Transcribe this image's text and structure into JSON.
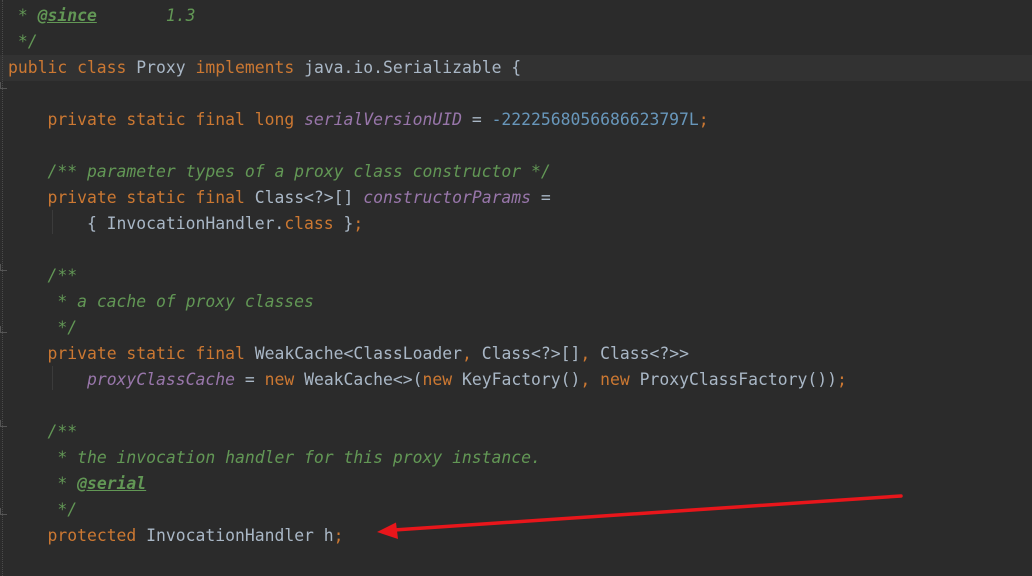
{
  "editor": {
    "lines": [
      {
        "tokens": [
          {
            "c": "cm",
            "t": " * "
          },
          {
            "c": "tag",
            "t": "@since"
          },
          {
            "c": "cm",
            "t": "       1.3"
          }
        ]
      },
      {
        "tokens": [
          {
            "c": "cm",
            "t": " */"
          }
        ]
      },
      {
        "tokens": [
          {
            "c": "kw",
            "t": "public class "
          },
          {
            "c": "plain",
            "t": "Proxy "
          },
          {
            "c": "kw",
            "t": "implements "
          },
          {
            "c": "plain",
            "t": "java.io.Serializable {"
          }
        ],
        "current": true
      },
      {
        "tokens": []
      },
      {
        "tokens": [
          {
            "c": "plain",
            "t": "    "
          },
          {
            "c": "kw",
            "t": "private static final long "
          },
          {
            "c": "fld",
            "t": "serialVersionUID"
          },
          {
            "c": "plain",
            "t": " = "
          },
          {
            "c": "num",
            "t": "-2222568056686623797L"
          },
          {
            "c": "kw",
            "t": ";"
          }
        ]
      },
      {
        "tokens": []
      },
      {
        "tokens": [
          {
            "c": "plain",
            "t": "    "
          },
          {
            "c": "cm",
            "t": "/** parameter types of a proxy class constructor */"
          }
        ]
      },
      {
        "tokens": [
          {
            "c": "plain",
            "t": "    "
          },
          {
            "c": "kw",
            "t": "private static final "
          },
          {
            "c": "plain",
            "t": "Class<?>[] "
          },
          {
            "c": "fld",
            "t": "constructorParams"
          },
          {
            "c": "plain",
            "t": " ="
          }
        ]
      },
      {
        "tokens": [
          {
            "c": "plain",
            "t": "        { InvocationHandler."
          },
          {
            "c": "kw",
            "t": "class"
          },
          {
            "c": "plain",
            "t": " }"
          },
          {
            "c": "kw",
            "t": ";"
          }
        ]
      },
      {
        "tokens": []
      },
      {
        "tokens": [
          {
            "c": "plain",
            "t": "    "
          },
          {
            "c": "cm",
            "t": "/**"
          }
        ]
      },
      {
        "tokens": [
          {
            "c": "plain",
            "t": "     "
          },
          {
            "c": "cm",
            "t": "* a cache of proxy classes"
          }
        ]
      },
      {
        "tokens": [
          {
            "c": "plain",
            "t": "     "
          },
          {
            "c": "cm",
            "t": "*/"
          }
        ]
      },
      {
        "tokens": [
          {
            "c": "plain",
            "t": "    "
          },
          {
            "c": "kw",
            "t": "private static final "
          },
          {
            "c": "plain",
            "t": "WeakCache<ClassLoader"
          },
          {
            "c": "kw",
            "t": ", "
          },
          {
            "c": "plain",
            "t": "Class<?>[]"
          },
          {
            "c": "kw",
            "t": ", "
          },
          {
            "c": "plain",
            "t": "Class<?>>"
          }
        ]
      },
      {
        "tokens": [
          {
            "c": "plain",
            "t": "        "
          },
          {
            "c": "fld",
            "t": "proxyClassCache"
          },
          {
            "c": "plain",
            "t": " = "
          },
          {
            "c": "kw",
            "t": "new "
          },
          {
            "c": "plain",
            "t": "WeakCache<>("
          },
          {
            "c": "kw",
            "t": "new "
          },
          {
            "c": "plain",
            "t": "KeyFactory()"
          },
          {
            "c": "kw",
            "t": ", new "
          },
          {
            "c": "plain",
            "t": "ProxyClassFactory())"
          },
          {
            "c": "kw",
            "t": ";"
          }
        ]
      },
      {
        "tokens": []
      },
      {
        "tokens": [
          {
            "c": "plain",
            "t": "    "
          },
          {
            "c": "cm",
            "t": "/**"
          }
        ]
      },
      {
        "tokens": [
          {
            "c": "plain",
            "t": "     "
          },
          {
            "c": "cm",
            "t": "* the invocation handler for this proxy instance."
          }
        ]
      },
      {
        "tokens": [
          {
            "c": "plain",
            "t": "     "
          },
          {
            "c": "cm",
            "t": "* "
          },
          {
            "c": "tag",
            "t": "@serial"
          }
        ]
      },
      {
        "tokens": [
          {
            "c": "plain",
            "t": "     "
          },
          {
            "c": "cm",
            "t": "*/"
          }
        ]
      },
      {
        "tokens": [
          {
            "c": "plain",
            "t": "    "
          },
          {
            "c": "kw",
            "t": "protected "
          },
          {
            "c": "plain",
            "t": "InvocationHandler h"
          },
          {
            "c": "kw",
            "t": ";"
          }
        ]
      }
    ]
  },
  "annotation": {
    "type": "arrow",
    "color": "#e8161b",
    "points_to": "protected InvocationHandler h;"
  }
}
